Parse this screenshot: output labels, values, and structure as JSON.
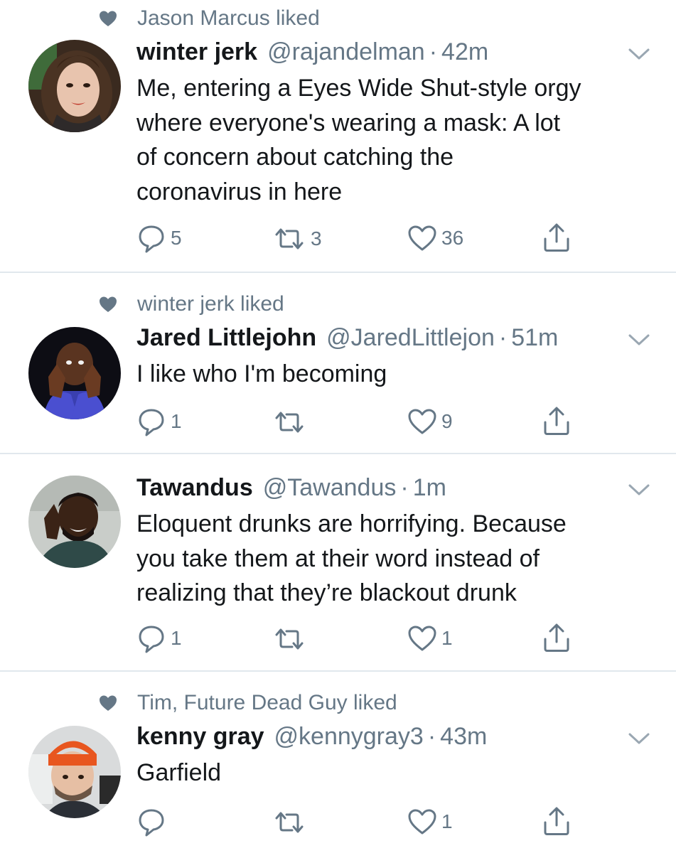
{
  "tweets": [
    {
      "liked_by": "Jason Marcus liked",
      "name": "winter jerk",
      "handle": "@rajandelman",
      "time": "42m",
      "text": "Me, entering a Eyes Wide Shut-style orgy\nwhere everyone's wearing a mask: A lot\nof concern about catching the\ncoronavirus in here",
      "replies": "5",
      "retweets": "3",
      "likes": "36"
    },
    {
      "liked_by": "winter jerk liked",
      "name": "Jared Littlejohn",
      "handle": "@JaredLittlejon",
      "time": "51m",
      "text": "I like who I'm becoming",
      "replies": "1",
      "retweets": "",
      "likes": "9"
    },
    {
      "liked_by": "",
      "name": "Tawandus",
      "handle": "@Tawandus",
      "time": "1m",
      "text": "Eloquent drunks are horrifying. Because\nyou take them at their word instead of\nrealizing that they’re blackout drunk",
      "replies": "1",
      "retweets": "",
      "likes": "1"
    },
    {
      "liked_by": "Tim, Future Dead Guy liked",
      "name": "kenny gray",
      "handle": "@kennygray3",
      "time": "43m",
      "text": "Garfield",
      "replies": "",
      "retweets": "",
      "likes": "1"
    }
  ],
  "icons": {
    "liked_indicator": "heart-icon",
    "caret": "chevron-down-icon",
    "reply": "reply-icon",
    "retweet": "retweet-icon",
    "like": "like-icon",
    "share": "share-icon"
  },
  "colors": {
    "secondary_text": "#657786",
    "primary_text": "#14171a",
    "divider": "#e1e8ed"
  }
}
